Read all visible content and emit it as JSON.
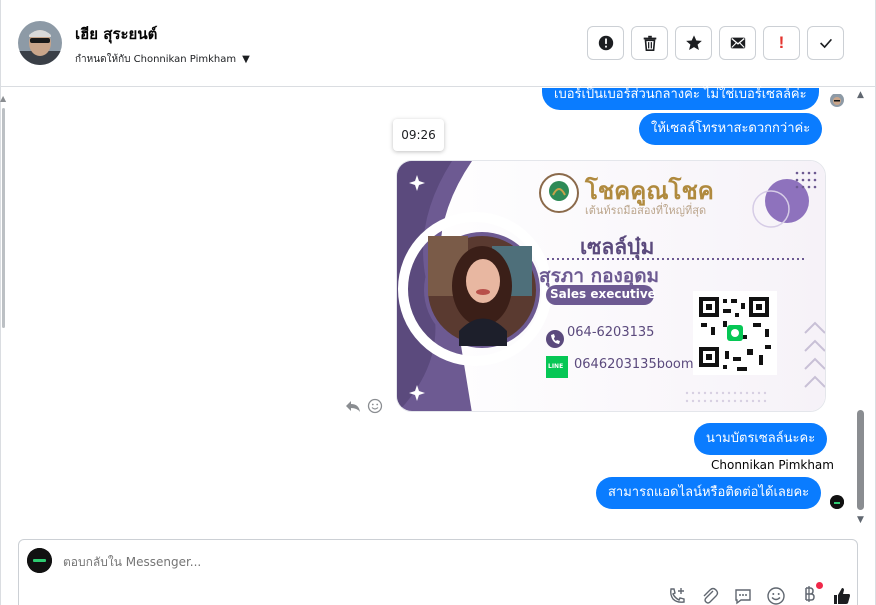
{
  "header": {
    "contact_name": "เฮีย สุระยนต์",
    "assignment": "กำหนดให้กับ Chonnikan Pimkham",
    "toolbar": {
      "spam_label": "Mark as spam",
      "delete_label": "Delete",
      "star_label": "Star",
      "unread_label": "Mark as unread",
      "follow_up_label": "Follow up",
      "done_label": "Done",
      "follow_up_glyph": "!"
    }
  },
  "conversation": {
    "messages": [
      {
        "text": "เบอร์เป็นเบอร์ส่วนกลางค่ะ ไม่ใช่เบอร์เซลล์ค่ะ"
      },
      {
        "text": "ให้เซลล์โทรหาสะดวกกว่าค่ะ"
      },
      {
        "text": "นามบัตรเซลล์นะคะ"
      },
      {
        "text": "สามารถแอดไลน์หรือติดต่อได้เลยคะ"
      }
    ],
    "timestamp": "09:26",
    "sender_label": "Chonnikan Pimkham",
    "business_card": {
      "brand": "โชคคูณโชค",
      "tagline": "เต้นท์รถมือสองที่ใหญ่ที่สุด",
      "nickname": "เซลล์บุ๋ม",
      "full_name": "สุรภา   กองอุดม",
      "role": "Sales executive",
      "phone": "064-6203135",
      "line_badge": "LINE",
      "line_id": "0646203135boom",
      "accent_color": "#6d5a92"
    }
  },
  "composer": {
    "placeholder": "ตอบกลับใน Messenger..."
  },
  "colors": {
    "bubble": "#0a7cff",
    "accent_purple": "#6d5a92"
  }
}
